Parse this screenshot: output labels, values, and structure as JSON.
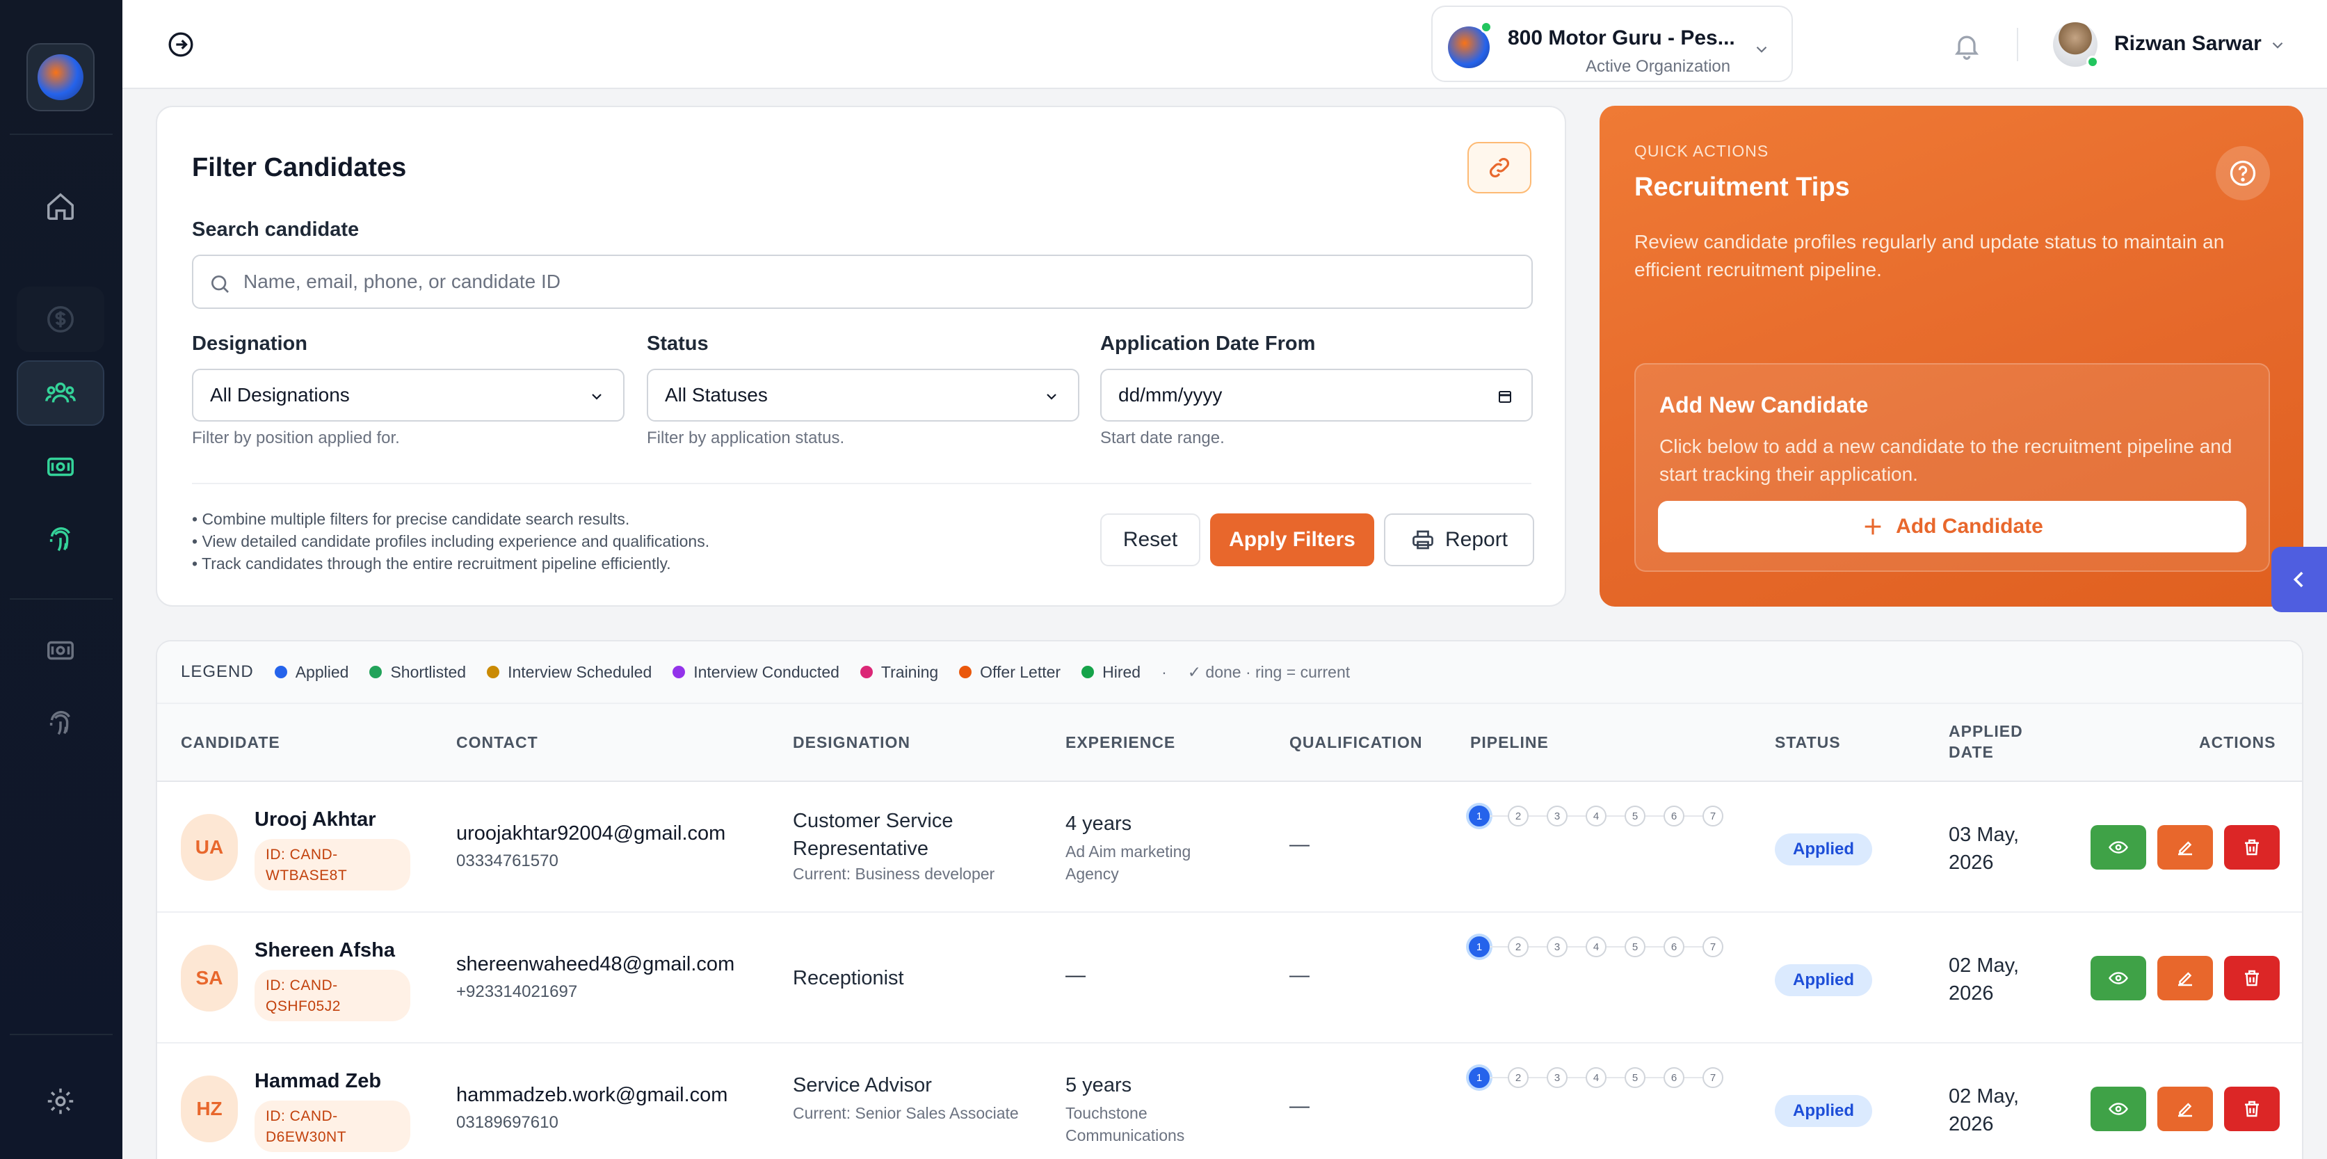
{
  "topbar": {
    "org_name": "800 Motor Guru - Pes...",
    "org_sub": "Active Organization",
    "user_name": "Rizwan Sarwar"
  },
  "filter": {
    "title": "Filter Candidates",
    "search_label": "Search candidate",
    "search_placeholder": "Name, email, phone, or candidate ID",
    "search_value": "",
    "designation_label": "Designation",
    "designation_value": "All Designations",
    "designation_hint": "Filter by position applied for.",
    "status_label": "Status",
    "status_value": "All Statuses",
    "status_hint": "Filter by application status.",
    "date_label": "Application Date From",
    "date_value": "dd/mm/yyyy",
    "date_hint": "Start date range.",
    "tips": [
      "• Combine multiple filters for precise candidate search results.",
      "• View detailed candidate profiles including experience and qualifications.",
      "• Track candidates through the entire recruitment pipeline efficiently."
    ],
    "reset_label": "Reset",
    "apply_label": "Apply Filters",
    "report_label": "Report"
  },
  "quick_actions": {
    "eyebrow": "QUICK ACTIONS",
    "title": "Recruitment Tips",
    "description": "Review candidate profiles regularly and update status to maintain an efficient recruitment pipeline.",
    "add_title": "Add New Candidate",
    "add_description": "Click below to add a new candidate to the recruitment pipeline and start tracking their application.",
    "add_button": "Add Candidate"
  },
  "legend": {
    "title": "LEGEND",
    "items": [
      {
        "label": "Applied",
        "color": "#2563eb"
      },
      {
        "label": "Shortlisted",
        "color": "#22a35a"
      },
      {
        "label": "Interview Scheduled",
        "color": "#ca8a04"
      },
      {
        "label": "Interview Conducted",
        "color": "#9333ea"
      },
      {
        "label": "Training",
        "color": "#db2777"
      },
      {
        "label": "Offer Letter",
        "color": "#ea580c"
      },
      {
        "label": "Hired",
        "color": "#16a34a"
      }
    ],
    "separator": "·",
    "note": "✓ done · ring = current"
  },
  "table": {
    "headers": {
      "candidate": "CANDIDATE",
      "contact": "CONTACT",
      "designation": "DESIGNATION",
      "experience": "EXPERIENCE",
      "qualification": "QUALIFICATION",
      "pipeline": "PIPELINE",
      "status": "STATUS",
      "applied_1": "APPLIED",
      "applied_2": "DATE",
      "actions": "ACTIONS"
    },
    "pipeline_steps": [
      "1",
      "2",
      "3",
      "4",
      "5",
      "6",
      "7"
    ],
    "rows": [
      {
        "initials": "UA",
        "name": "Urooj Akhtar",
        "id_1": "ID: CAND-",
        "id_2": "WTBASE8T",
        "email": "uroojakhtar92004@gmail.com",
        "phone": "03334761570",
        "designation_1": "Customer Service",
        "designation_2": "Representative",
        "designation_sub": "Current: Business developer",
        "experience": "4 years",
        "experience_sub_1": "Ad Aim marketing",
        "experience_sub_2": "Agency",
        "qualification": "—",
        "status": "Applied",
        "date_1": "03 May,",
        "date_2": "2026",
        "current_step": 1
      },
      {
        "initials": "SA",
        "name": "Shereen Afsha",
        "id_1": "ID: CAND-",
        "id_2": "QSHF05J2",
        "email": "shereenwaheed48@gmail.com",
        "phone": "+923314021697",
        "designation_1": "Receptionist",
        "designation_2": "",
        "designation_sub": "",
        "experience": "—",
        "experience_sub_1": "",
        "experience_sub_2": "",
        "qualification": "—",
        "status": "Applied",
        "date_1": "02 May,",
        "date_2": "2026",
        "current_step": 1
      },
      {
        "initials": "HZ",
        "name": "Hammad Zeb",
        "id_1": "ID: CAND-",
        "id_2": "D6EW30NT",
        "email": "hammadzeb.work@gmail.com",
        "phone": "03189697610",
        "designation_1": "Service Advisor",
        "designation_2": "",
        "designation_sub": "Current: Senior Sales Associate",
        "experience": "5 years",
        "experience_sub_1": "Touchstone",
        "experience_sub_2": "Communications",
        "qualification": "—",
        "status": "Applied",
        "date_1": "02 May,",
        "date_2": "2026",
        "current_step": 1
      }
    ]
  }
}
